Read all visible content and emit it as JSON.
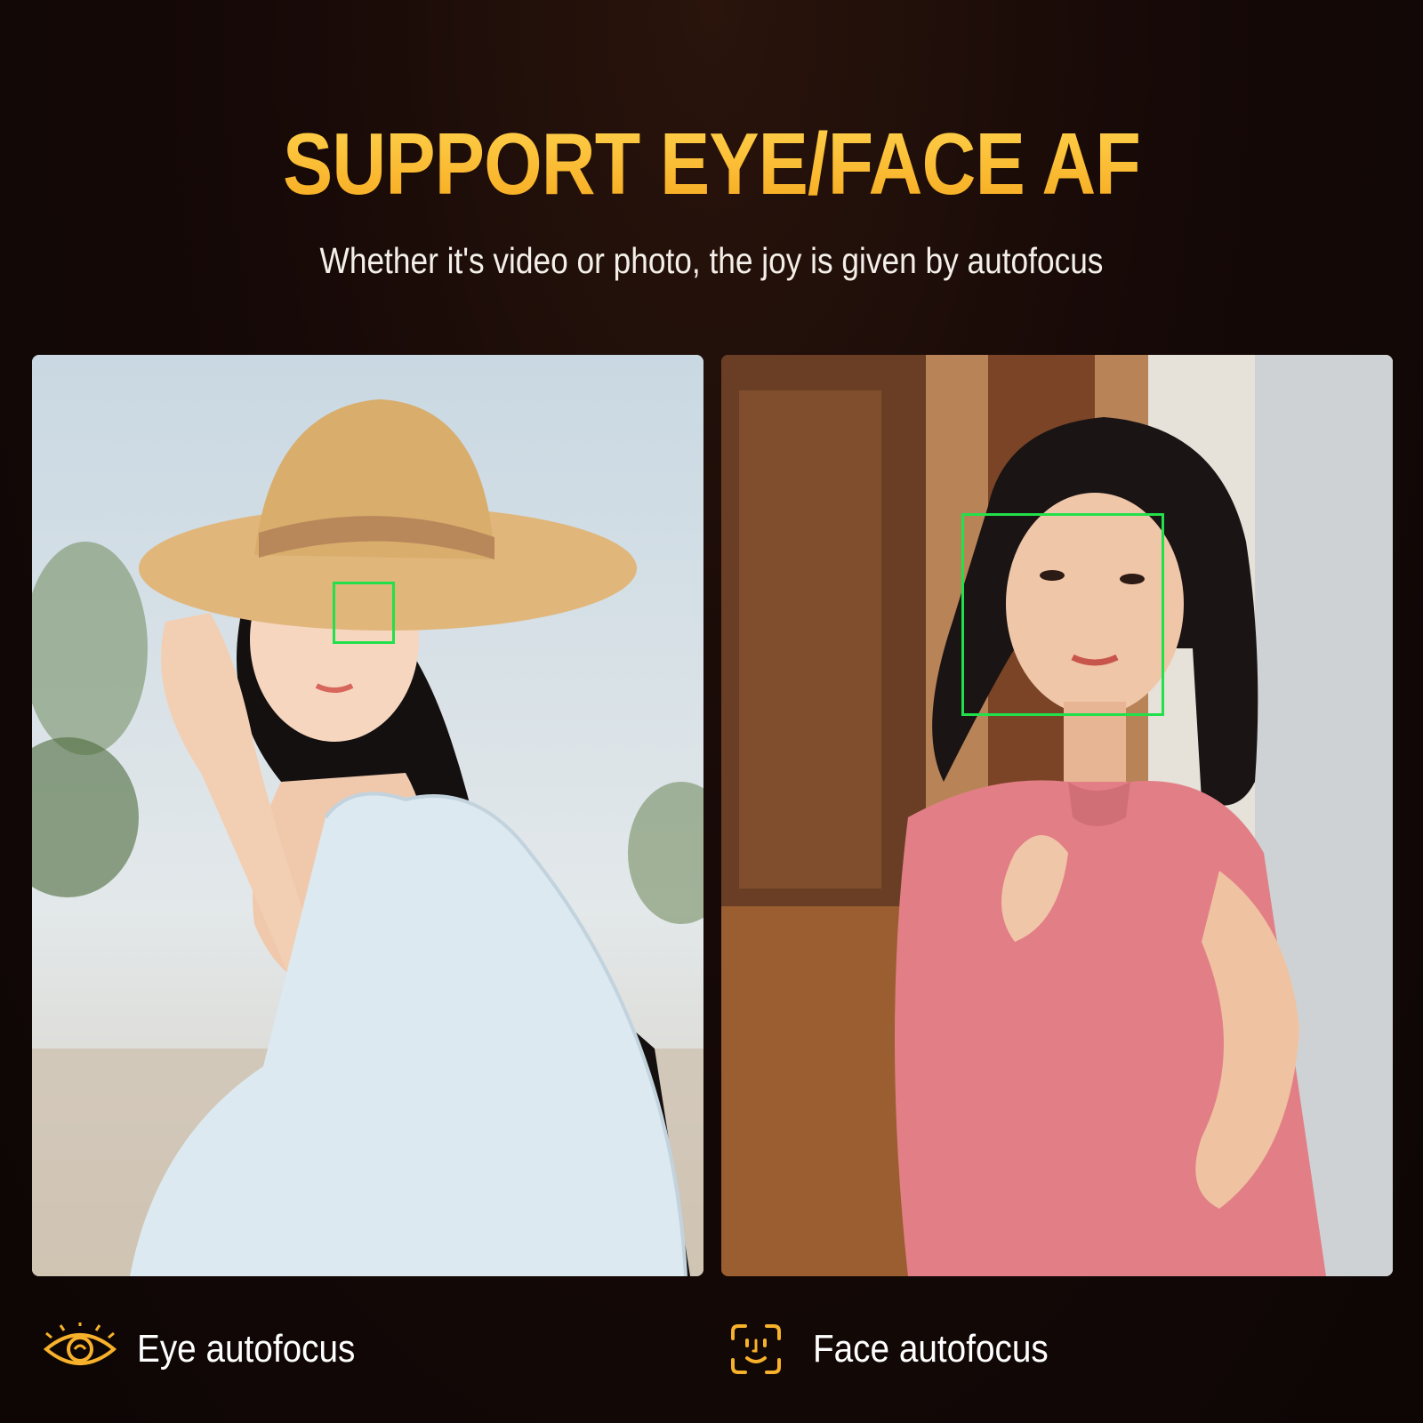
{
  "headline": "SUPPORT EYE/FACE AF",
  "subtitle": "Whether it's video or photo, the joy is given by autofocus",
  "features": [
    {
      "label": "Eye autofocus",
      "icon": "eye-icon"
    },
    {
      "label": "Face autofocus",
      "icon": "face-scan-icon"
    }
  ],
  "colors": {
    "accent": "#f7b12a",
    "focus_box": "#22e04a",
    "background": "#140806"
  }
}
